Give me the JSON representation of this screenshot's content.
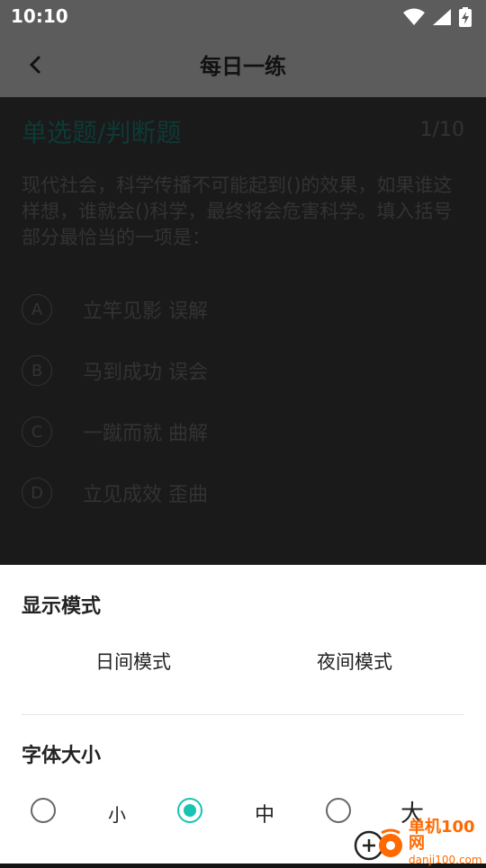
{
  "status_bar": {
    "time": "10:10"
  },
  "app_bar": {
    "title": "每日一练",
    "back_icon": "chevron-left-icon"
  },
  "question": {
    "type": "单选题/判断题",
    "progress": "1/10",
    "text": "现代社会，科学传播不可能起到()的效果，如果谁这样想，谁就会()科学，最终将会危害科学。填入括号部分最恰当的一项是：",
    "options": [
      {
        "letter": "A",
        "text": "立竿见影 误解"
      },
      {
        "letter": "B",
        "text": "马到成功 误会"
      },
      {
        "letter": "C",
        "text": "一蹴而就 曲解"
      },
      {
        "letter": "D",
        "text": "立见成效 歪曲"
      }
    ]
  },
  "sheet": {
    "display_mode_title": "显示模式",
    "day_mode": "日间模式",
    "night_mode": "夜间模式",
    "font_size_title": "字体大小",
    "font_sizes": [
      {
        "label": "小",
        "selected": false
      },
      {
        "label": "中",
        "selected": true
      },
      {
        "label": "大",
        "selected": false
      }
    ]
  },
  "watermark": {
    "brand": "单机100网",
    "domain": "danji100.com"
  },
  "colors": {
    "accent": "#17c3b2",
    "overlay": "#5c5c5c",
    "watermark": "#ff6a00"
  }
}
